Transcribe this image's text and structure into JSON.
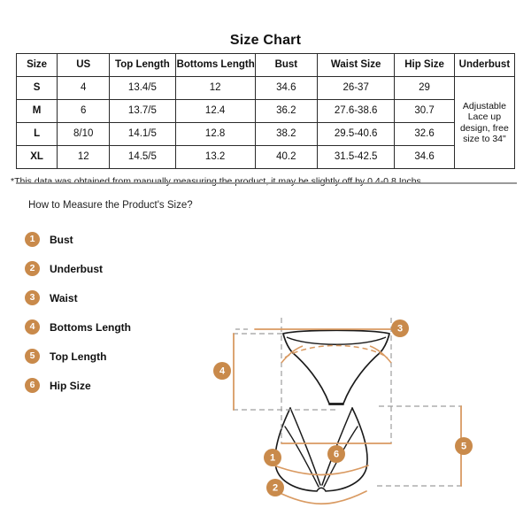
{
  "chart": {
    "title": "Size Chart",
    "columns": [
      "Size",
      "US",
      "Top Length",
      "Bottoms Length",
      "Bust",
      "Waist Size",
      "Hip Size",
      "Underbust"
    ],
    "rows": [
      {
        "size": "S",
        "us": "4",
        "top_length": "13.4/5",
        "bottoms_length": "12",
        "bust": "34.6",
        "waist_size": "26-37",
        "hip_size": "29"
      },
      {
        "size": "M",
        "us": "6",
        "top_length": "13.7/5",
        "bottoms_length": "12.4",
        "bust": "36.2",
        "waist_size": "27.6-38.6",
        "hip_size": "30.7"
      },
      {
        "size": "L",
        "us": "8/10",
        "top_length": "14.1/5",
        "bottoms_length": "12.8",
        "bust": "38.2",
        "waist_size": "29.5-40.6",
        "hip_size": "32.6"
      },
      {
        "size": "XL",
        "us": "12",
        "top_length": "14.5/5",
        "bottoms_length": "13.2",
        "bust": "40.2",
        "waist_size": "31.5-42.5",
        "hip_size": "34.6"
      }
    ],
    "underbust_merged_value": "Adjustable Lace up design, free size to 34\"",
    "note": "*This data was obtained from manually measuring the product, it may be slightly off by 0.4-0.8 Inchs."
  },
  "measure": {
    "heading": "How to Measure the Product's Size?",
    "legend": [
      {
        "number": "1",
        "label": "Bust"
      },
      {
        "number": "2",
        "label": "Underbust"
      },
      {
        "number": "3",
        "label": "Waist"
      },
      {
        "number": "4",
        "label": "Bottoms Length"
      },
      {
        "number": "5",
        "label": "Top Length"
      },
      {
        "number": "6",
        "label": "Hip Size"
      }
    ],
    "diagram_markers": [
      {
        "number": "1",
        "measures": "Bust"
      },
      {
        "number": "2",
        "measures": "Underbust"
      },
      {
        "number": "3",
        "measures": "Waist"
      },
      {
        "number": "4",
        "measures": "Bottoms Length"
      },
      {
        "number": "5",
        "measures": "Top Length"
      },
      {
        "number": "6",
        "measures": "Hip Size"
      }
    ]
  },
  "colors": {
    "accent": "#c98a4b",
    "measure_line": "#d99a62",
    "guide_line": "#9e9e9e",
    "garment_outline": "#1a1a1a",
    "divider": "#9a9a9a",
    "table_border": "#2b2b2b",
    "background": "#ffffff"
  }
}
